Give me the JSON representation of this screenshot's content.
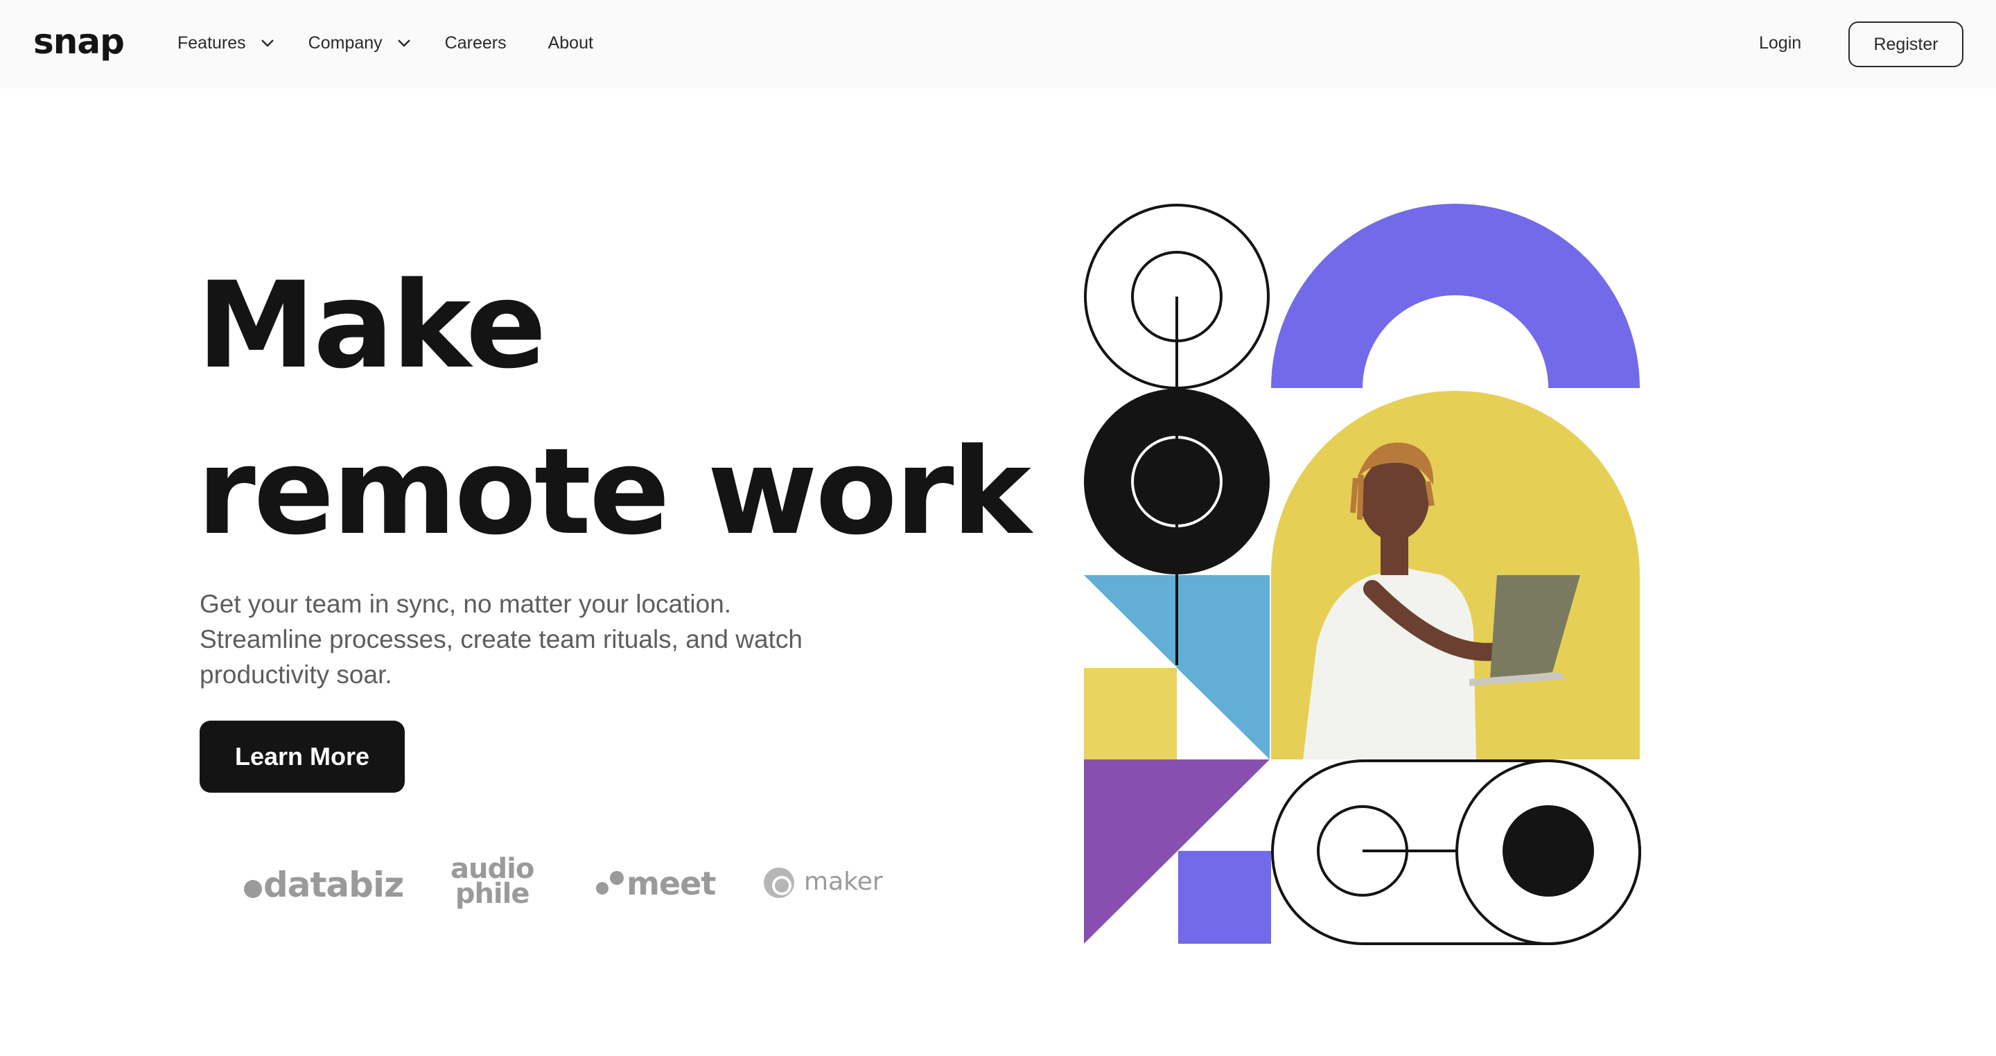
{
  "header": {
    "logo": "snap",
    "nav": [
      {
        "label": "Features",
        "has_dropdown": true
      },
      {
        "label": "Company",
        "has_dropdown": true
      },
      {
        "label": "Careers",
        "has_dropdown": false
      },
      {
        "label": "About",
        "has_dropdown": false
      }
    ],
    "login_label": "Login",
    "register_label": "Register"
  },
  "hero": {
    "title_line1": "Make",
    "title_line2": "remote work",
    "subtitle": "Get your team in sync, no matter your location. Streamline processes, create team rituals, and watch productivity soar.",
    "cta_label": "Learn More"
  },
  "clients": {
    "databiz": "databiz",
    "audiophile_line1": "audio",
    "audiophile_line2": "phile",
    "meet": "meet",
    "maker": "maker"
  },
  "colors": {
    "text_dark": "#141414",
    "text_muted": "#5d5d5d",
    "logo_gray": "#9a9a9a",
    "purple": "#726ae8",
    "yellow": "#e8d45e",
    "blue": "#62aed7",
    "violet": "#8650b0"
  },
  "icons": [
    "chevron-down-icon",
    "lock-illustration"
  ]
}
